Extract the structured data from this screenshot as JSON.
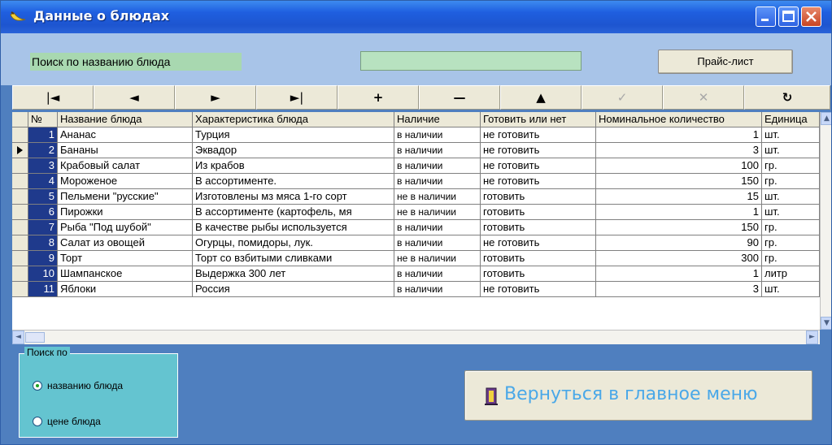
{
  "window": {
    "title": "Данные о блюдах"
  },
  "search": {
    "label": "Поиск по названию блюда",
    "value": "",
    "price_button": "Прайс-лист"
  },
  "navigator": [
    {
      "icon": "first-record-icon",
      "symbol": "|◄",
      "enabled": true
    },
    {
      "icon": "prior-record-icon",
      "symbol": "◄",
      "enabled": true
    },
    {
      "icon": "next-record-icon",
      "symbol": "►",
      "enabled": true
    },
    {
      "icon": "last-record-icon",
      "symbol": "►|",
      "enabled": true
    },
    {
      "icon": "insert-record-icon",
      "symbol": "+",
      "enabled": true
    },
    {
      "icon": "delete-record-icon",
      "symbol": "—",
      "enabled": true
    },
    {
      "icon": "edit-record-icon",
      "symbol": "▲",
      "enabled": true
    },
    {
      "icon": "post-edit-icon",
      "symbol": "✓",
      "enabled": false
    },
    {
      "icon": "cancel-edit-icon",
      "symbol": "✕",
      "enabled": false
    },
    {
      "icon": "refresh-icon",
      "symbol": "↻",
      "enabled": true
    }
  ],
  "table": {
    "columns": [
      "№",
      "Название блюда",
      "Характеристика блюда",
      "Наличие",
      "Готовить или нет",
      "Номинальное количество",
      "Единица"
    ],
    "current_row": 1,
    "rows": [
      [
        "1",
        "Ананас",
        "Турция",
        "в наличии",
        "не готовить",
        "1",
        "шт."
      ],
      [
        "2",
        "Бананы",
        "Эквадор",
        "в наличии",
        "не готовить",
        "3",
        "шт."
      ],
      [
        "3",
        "Крабовый салат",
        "Из крабов",
        "в наличии",
        "не готовить",
        "100",
        "гр."
      ],
      [
        "4",
        "Мороженое",
        "В ассортименте.",
        "в наличии",
        "не готовить",
        "150",
        "гр."
      ],
      [
        "5",
        "Пельмени \"русские\"",
        "Изготовлены мз мяса 1-го сорт",
        "не в наличии",
        "готовить",
        "15",
        "шт."
      ],
      [
        "6",
        "Пирожки",
        "В ассортименте (картофель, мя",
        "не в наличии",
        "готовить",
        "1",
        "шт."
      ],
      [
        "7",
        "Рыба \"Под шубой\"",
        "В качестве рыбы используется",
        "в наличии",
        "готовить",
        "150",
        "гр."
      ],
      [
        "8",
        "Салат из овощей",
        "Огурцы, помидоры, лук.",
        "в наличии",
        "не готовить",
        "90",
        "гр."
      ],
      [
        "9",
        "Торт",
        "Торт со взбитыми сливками",
        "не в наличии",
        "готовить",
        "300",
        "гр."
      ],
      [
        "10",
        "Шампанское",
        "Выдержка 300 лет",
        "в наличии",
        "готовить",
        "1",
        "литр"
      ],
      [
        "11",
        "Яблоки",
        "Россия",
        "в наличии",
        "не готовить",
        "3",
        "шт."
      ]
    ]
  },
  "search_by": {
    "title": "Поиск по",
    "options": [
      {
        "label": "названию блюда",
        "selected": true
      },
      {
        "label": "цене блюда",
        "selected": false
      }
    ]
  },
  "back_button": {
    "label": "Вернуться в главное меню"
  },
  "colors": {
    "form_background": "#4f7fbf",
    "top_panel": "#a8c4e8",
    "search_field": "#b8e2c0",
    "groupbox": "#64c4d0",
    "number_cell": "#1f3a8c",
    "back_button_text": "#4aa8e8"
  }
}
